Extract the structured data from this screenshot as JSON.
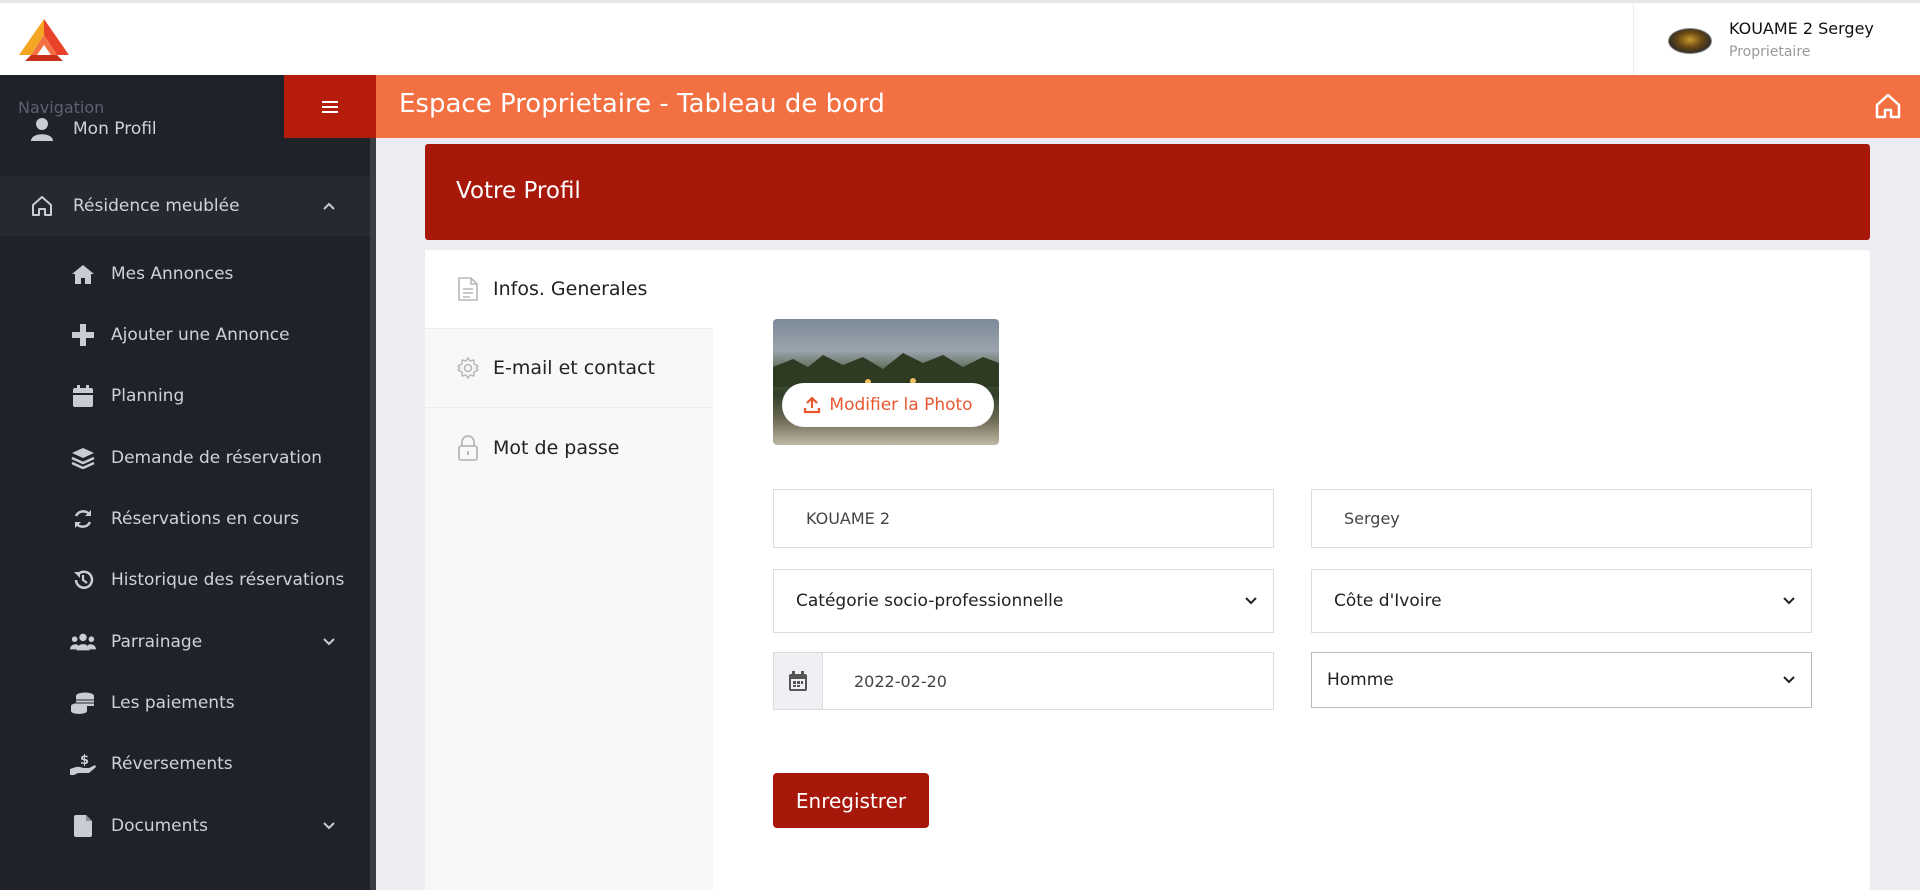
{
  "header": {
    "user_name": "KOUAME 2 Sergey",
    "user_role": "Proprietaire"
  },
  "sidebar": {
    "nav_title": "Navigation",
    "items": [
      {
        "label": "Mon Profil",
        "icon": "user-icon"
      },
      {
        "label": "Résidence meublée",
        "icon": "home-outline-icon",
        "expanded": true
      },
      {
        "label": "Mes Annonces",
        "icon": "house-icon"
      },
      {
        "label": "Ajouter une Annonce",
        "icon": "plus-icon"
      },
      {
        "label": "Planning",
        "icon": "calendar-icon"
      },
      {
        "label": "Demande de réservation",
        "icon": "layers-icon"
      },
      {
        "label": "Réservations en cours",
        "icon": "sync-icon"
      },
      {
        "label": "Historique des réservations",
        "icon": "history-icon"
      },
      {
        "label": "Parrainage",
        "icon": "users-icon",
        "expandable": true
      },
      {
        "label": "Les paiements",
        "icon": "coins-icon"
      },
      {
        "label": "Réversements",
        "icon": "hand-dollar-icon"
      },
      {
        "label": "Documents",
        "icon": "file-icon",
        "expandable": true
      }
    ]
  },
  "titlebar": {
    "title": "Espace Proprietaire - Tableau de bord"
  },
  "profile": {
    "header": "Votre Profil",
    "tabs": [
      {
        "label": "Infos. Generales",
        "icon": "document-icon",
        "active": true
      },
      {
        "label": "E-mail et contact",
        "icon": "gear-icon"
      },
      {
        "label": "Mot de passe",
        "icon": "lock-icon"
      }
    ],
    "photo_button": "Modifier la Photo",
    "form": {
      "last_name": "KOUAME 2",
      "first_name": "Sergey",
      "category": "Catégorie socio-professionnelle",
      "country": "Côte d'Ivoire",
      "birth_date": "2022-02-20",
      "gender": "Homme"
    },
    "save_label": "Enregistrer"
  },
  "colors": {
    "accent_orange": "#f37042",
    "accent_red": "#a8180a",
    "sidebar_bg": "#1f2229"
  }
}
